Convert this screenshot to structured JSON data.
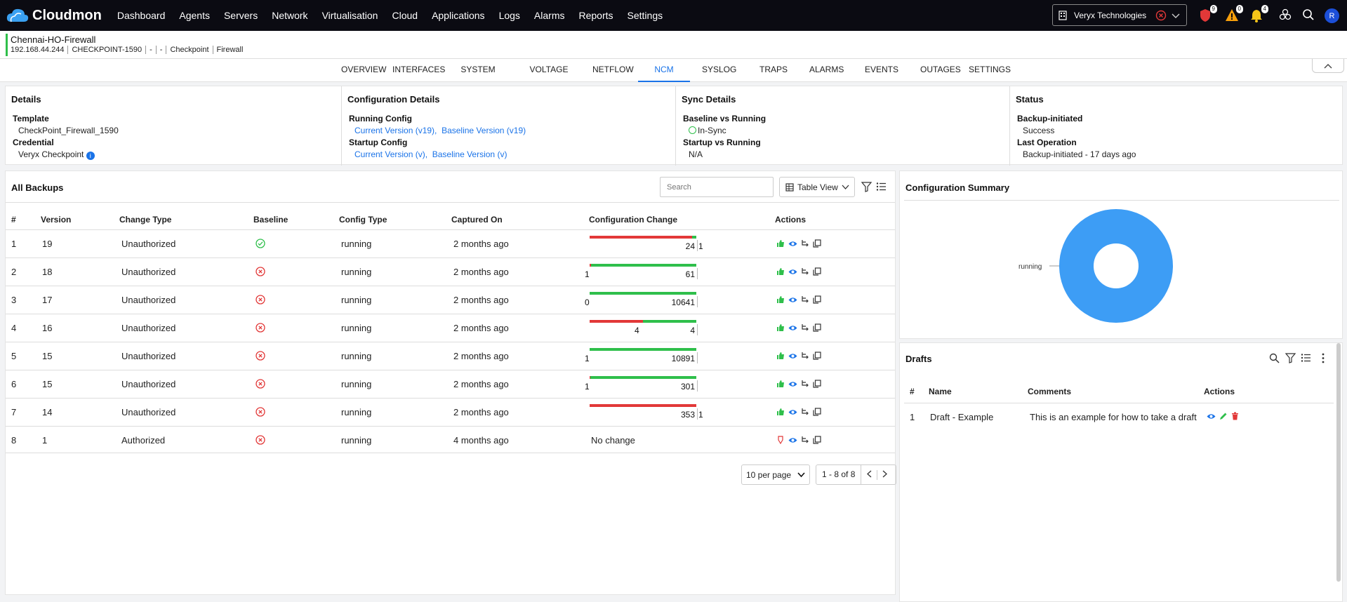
{
  "app": {
    "name": "Cloudmon"
  },
  "nav": [
    "Dashboard",
    "Agents",
    "Servers",
    "Network",
    "Virtualisation",
    "Cloud",
    "Applications",
    "Logs",
    "Alarms",
    "Reports",
    "Settings"
  ],
  "org": {
    "name": "Veryx Technologies"
  },
  "badges": {
    "shield": "9",
    "warning": "0",
    "bell": "4"
  },
  "user": {
    "initial": "R"
  },
  "device": {
    "name": "Chennai-HO-Firewall",
    "meta": [
      "192.168.44.244",
      "CHECKPOINT-1590",
      "-",
      "-",
      "Checkpoint",
      "Firewall"
    ]
  },
  "tabs": [
    "OVERVIEW",
    "INTERFACES",
    "SYSTEM METRICS",
    "VOLTAGE HEALTH",
    "NETFLOW",
    "NCM",
    "SYSLOG",
    "TRAPS",
    "ALARMS",
    "EVENTS",
    "OUTAGES",
    "SETTINGS"
  ],
  "active_tab": "NCM",
  "details": {
    "title": "Details",
    "template_label": "Template",
    "template_value": "CheckPoint_Firewall_1590",
    "credential_label": "Credential",
    "credential_value": "Veryx Checkpoint",
    "info": "i"
  },
  "config_details": {
    "title": "Configuration Details",
    "running_label": "Running Config",
    "running_current": "Current Version (v19),",
    "running_baseline": "Baseline Version (v19)",
    "startup_label": "Startup Config",
    "startup_current": "Current Version (v),",
    "startup_baseline": "Baseline Version (v)"
  },
  "sync_details": {
    "title": "Sync Details",
    "baseline_label": "Baseline vs Running",
    "baseline_value": "In-Sync",
    "startup_label": "Startup vs Running",
    "startup_value": "N/A"
  },
  "status": {
    "title": "Status",
    "backup_label": "Backup-initiated",
    "backup_value": "Success",
    "last_label": "Last Operation",
    "last_value": "Backup-initiated - 17 days ago"
  },
  "backups": {
    "title": "All Backups",
    "search_placeholder": "Search",
    "view_label": "Table View",
    "columns": [
      "#",
      "Version",
      "Change Type",
      "Baseline",
      "Config Type",
      "Captured On",
      "Configuration Change",
      "Actions"
    ],
    "rows": [
      {
        "n": "1",
        "version": "19",
        "change": "Unauthorized",
        "baseline": "ok",
        "config": "running",
        "captured": "2 months ago",
        "removed": 24,
        "added": 1,
        "left": "",
        "right": "24",
        "tail": "1",
        "nochange": ""
      },
      {
        "n": "2",
        "version": "18",
        "change": "Unauthorized",
        "baseline": "x",
        "config": "running",
        "captured": "2 months ago",
        "removed": 1,
        "added": 61,
        "left": "1",
        "right": "61",
        "tail": "",
        "nochange": ""
      },
      {
        "n": "3",
        "version": "17",
        "change": "Unauthorized",
        "baseline": "x",
        "config": "running",
        "captured": "2 months ago",
        "removed": 0,
        "added": 10641,
        "left": "0",
        "right": "10641",
        "tail": "",
        "nochange": ""
      },
      {
        "n": "4",
        "version": "16",
        "change": "Unauthorized",
        "baseline": "x",
        "config": "running",
        "captured": "2 months ago",
        "removed": 4,
        "added": 4,
        "left": "",
        "right": "4",
        "tail": "",
        "mid": "4",
        "nochange": ""
      },
      {
        "n": "5",
        "version": "15",
        "change": "Unauthorized",
        "baseline": "x",
        "config": "running",
        "captured": "2 months ago",
        "removed": 1,
        "added": 10891,
        "left": "1",
        "right": "10891",
        "tail": "",
        "nochange": ""
      },
      {
        "n": "6",
        "version": "15",
        "change": "Unauthorized",
        "baseline": "x",
        "config": "running",
        "captured": "2 months ago",
        "removed": 1,
        "added": 301,
        "left": "1",
        "right": "301",
        "tail": "",
        "nochange": ""
      },
      {
        "n": "7",
        "version": "14",
        "change": "Unauthorized",
        "baseline": "x",
        "config": "running",
        "captured": "2 months ago",
        "removed": 353,
        "added": 1,
        "left": "",
        "right": "353",
        "tail": "1",
        "nochange": ""
      },
      {
        "n": "8",
        "version": "1",
        "change": "Authorized",
        "baseline": "x",
        "config": "running",
        "captured": "4 months ago",
        "removed": 0,
        "added": 0,
        "left": "",
        "right": "",
        "tail": "",
        "nochange": "No change"
      }
    ],
    "per_page": "10 per page",
    "range": "1 - 8 of 8"
  },
  "summary": {
    "title": "Configuration Summary",
    "chart_data": {
      "type": "pie",
      "categories": [
        "running"
      ],
      "values": [
        8
      ],
      "colors": [
        "#3d9df5"
      ]
    }
  },
  "drafts": {
    "title": "Drafts",
    "columns": [
      "#",
      "Name",
      "Comments",
      "Actions"
    ],
    "rows": [
      {
        "n": "1",
        "name": "Draft - Example",
        "comment": "This is an example for how to take a draft"
      }
    ]
  },
  "colors": {
    "accent": "#1a73e8",
    "added": "#2fbf4b",
    "removed": "#e23838"
  }
}
